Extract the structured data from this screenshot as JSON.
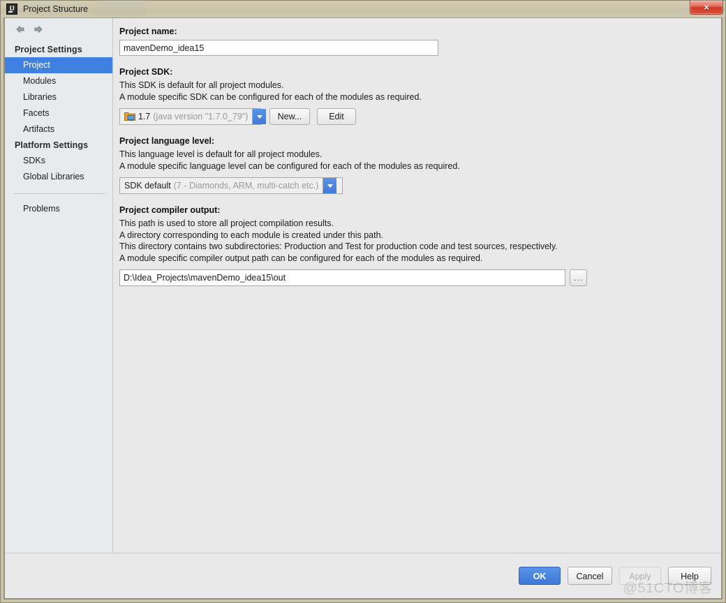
{
  "window": {
    "title": "Project Structure",
    "app_icon": "intellij-idea-logo",
    "close_label": "×"
  },
  "sidebar": {
    "nav": {
      "back_icon": "arrow-left-icon",
      "forward_icon": "arrow-right-icon"
    },
    "groups": [
      {
        "header": "Project Settings",
        "items": [
          {
            "label": "Project",
            "selected": true
          },
          {
            "label": "Modules",
            "selected": false
          },
          {
            "label": "Libraries",
            "selected": false
          },
          {
            "label": "Facets",
            "selected": false
          },
          {
            "label": "Artifacts",
            "selected": false
          }
        ]
      },
      {
        "header": "Platform Settings",
        "items": [
          {
            "label": "SDKs",
            "selected": false
          },
          {
            "label": "Global Libraries",
            "selected": false
          }
        ]
      }
    ],
    "problems_item": "Problems"
  },
  "content": {
    "project_name": {
      "label": "Project name:",
      "value": "mavenDemo_idea15"
    },
    "project_sdk": {
      "label": "Project SDK:",
      "desc_line1": "This SDK is default for all project modules.",
      "desc_line2": "A module specific SDK can be configured for each of the modules as required.",
      "selected": "1.7",
      "selected_detail": "(java version \"1.7.0_79\")",
      "icon": "sdk-folder-icon",
      "new_button": "New...",
      "edit_button": "Edit"
    },
    "language_level": {
      "label": "Project language level:",
      "desc_line1": "This language level is default for all project modules.",
      "desc_line2": "A module specific language level can be configured for each of the modules as required.",
      "selected": "SDK default",
      "selected_detail": "(7 - Diamonds, ARM, multi-catch etc.)"
    },
    "compiler_output": {
      "label": "Project compiler output:",
      "desc_line1": "This path is used to store all project compilation results.",
      "desc_line2": "A directory corresponding to each module is created under this path.",
      "desc_line3": "This directory contains two subdirectories: Production and Test for production code and test sources, respectively.",
      "desc_line4": "A module specific compiler output path can be configured for each of the modules as required.",
      "value": "D:\\Idea_Projects\\mavenDemo_idea15\\out",
      "browse_label": "..."
    }
  },
  "footer": {
    "ok": "OK",
    "cancel": "Cancel",
    "apply": "Apply",
    "help": "Help"
  },
  "watermark": "@51CTO博客",
  "colors": {
    "accent_blue": "#4080e0",
    "window_chrome": "#c9c4ab",
    "panel_bg": "#e9e9e9",
    "sidebar_bg": "#e7ebee",
    "close_red": "#cf3a27"
  }
}
